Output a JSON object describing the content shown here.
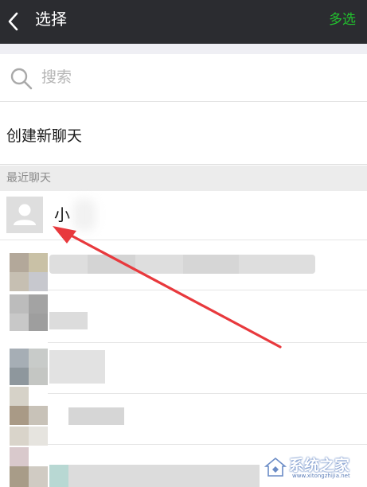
{
  "header": {
    "title": "选择",
    "multi_select_label": "多选"
  },
  "search": {
    "placeholder": "搜索"
  },
  "new_chat_label": "创建新聊天",
  "recent_section_label": "最近聊天",
  "contacts": [
    {
      "name": "小"
    }
  ],
  "watermark": {
    "text": "系统之家",
    "url": "www.xitongzhijia.net"
  },
  "colors": {
    "topbar": "#2b2c30",
    "accent_green": "#22c12e",
    "annotation_arrow": "#e8393d"
  }
}
